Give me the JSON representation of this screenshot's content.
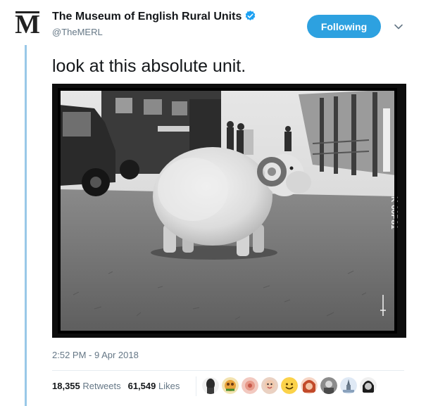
{
  "account": {
    "name": "The Museum of English Rural Units",
    "handle": "@TheMERL",
    "avatar_letter": "M",
    "verified": true
  },
  "follow_button": {
    "label": "Following"
  },
  "tweet": {
    "text": "look at this absolute unit.",
    "timestamp": "2:52 PM - 9 Apr 2018"
  },
  "photo": {
    "film_code": "K 60P81"
  },
  "stats": {
    "retweets_count": "18,355",
    "retweets_label": "Retweets",
    "likes_count": "61,549",
    "likes_label": "Likes"
  },
  "likers": [
    "liker-1",
    "liker-2",
    "liker-3",
    "liker-4",
    "liker-5",
    "liker-6",
    "liker-7",
    "liker-8",
    "liker-9"
  ],
  "colors": {
    "accent": "#2da1e0",
    "thread_line": "#99c8e8",
    "secondary_text": "#657786",
    "verified": "#1da1f2"
  }
}
